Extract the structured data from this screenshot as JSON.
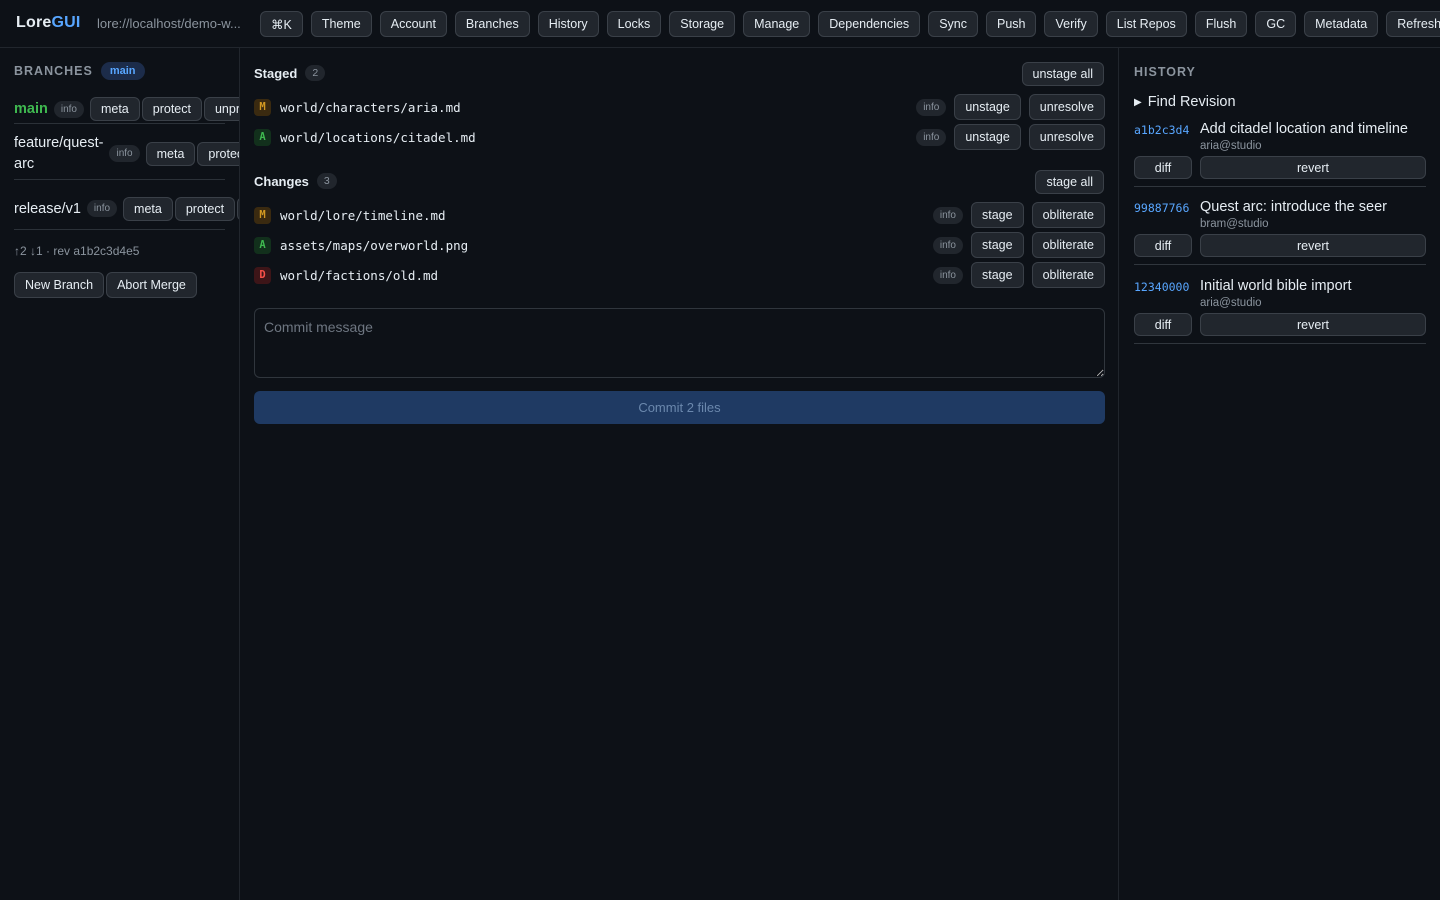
{
  "app": {
    "logo_main": "Lore",
    "logo_accent": "GUI",
    "repo_url": "lore://localhost/demo-w..."
  },
  "toolbar": {
    "buttons": [
      "⌘K",
      "Theme",
      "Account",
      "Branches",
      "History",
      "Locks",
      "Storage",
      "Manage",
      "Dependencies",
      "Sync",
      "Push",
      "Verify",
      "List Repos",
      "Flush",
      "GC",
      "Metadata",
      "Refresh"
    ]
  },
  "branches": {
    "title": "BRANCHES",
    "current_badge": "main",
    "items": [
      {
        "name": "main",
        "info": "info",
        "actions": [
          "meta",
          "protect",
          "unprote"
        ]
      },
      {
        "name": "feature/quest-arc",
        "info": "info",
        "actions": [
          "meta",
          "protect"
        ]
      },
      {
        "name": "release/v1",
        "info": "info",
        "actions": [
          "meta",
          "protect",
          "ur"
        ]
      }
    ],
    "stats": "↑2 ↓1 · rev a1b2c3d4e5",
    "new_branch": "New Branch",
    "abort_merge": "Abort Merge"
  },
  "staged": {
    "title": "Staged",
    "count": "2",
    "all_button": "unstage all",
    "files": [
      {
        "status": "M",
        "path": "world/characters/aria.md",
        "info": "info",
        "actions": [
          "unstage",
          "unresolve"
        ]
      },
      {
        "status": "A",
        "path": "world/locations/citadel.md",
        "info": "info",
        "actions": [
          "unstage",
          "unresolve"
        ]
      }
    ]
  },
  "changes": {
    "title": "Changes",
    "count": "3",
    "all_button": "stage all",
    "files": [
      {
        "status": "M",
        "path": "world/lore/timeline.md",
        "info": "info",
        "actions": [
          "stage",
          "obliterate"
        ]
      },
      {
        "status": "A",
        "path": "assets/maps/overworld.png",
        "info": "info",
        "actions": [
          "stage",
          "obliterate"
        ]
      },
      {
        "status": "D",
        "path": "world/factions/old.md",
        "info": "info",
        "actions": [
          "stage",
          "obliterate"
        ]
      }
    ]
  },
  "commit": {
    "placeholder": "Commit message",
    "button": "Commit 2 files"
  },
  "history": {
    "title": "HISTORY",
    "find_revision": "Find Revision",
    "find_arrow": "▶",
    "items": [
      {
        "hash": "a1b2c3d4",
        "message": "Add citadel location and timeline",
        "author": "aria@studio",
        "diff": "diff",
        "revert": "revert"
      },
      {
        "hash": "99887766",
        "message": "Quest arc: introduce the seer",
        "author": "bram@studio",
        "diff": "diff",
        "revert": "revert"
      },
      {
        "hash": "12340000",
        "message": "Initial world bible import",
        "author": "aria@studio",
        "diff": "diff",
        "revert": "revert"
      }
    ]
  },
  "colors": {
    "background": "#0d1117",
    "accent": "#58a6ff",
    "active_branch": "#3fb950",
    "modified": "#d29922",
    "added": "#3fb950",
    "deleted": "#f85149"
  }
}
